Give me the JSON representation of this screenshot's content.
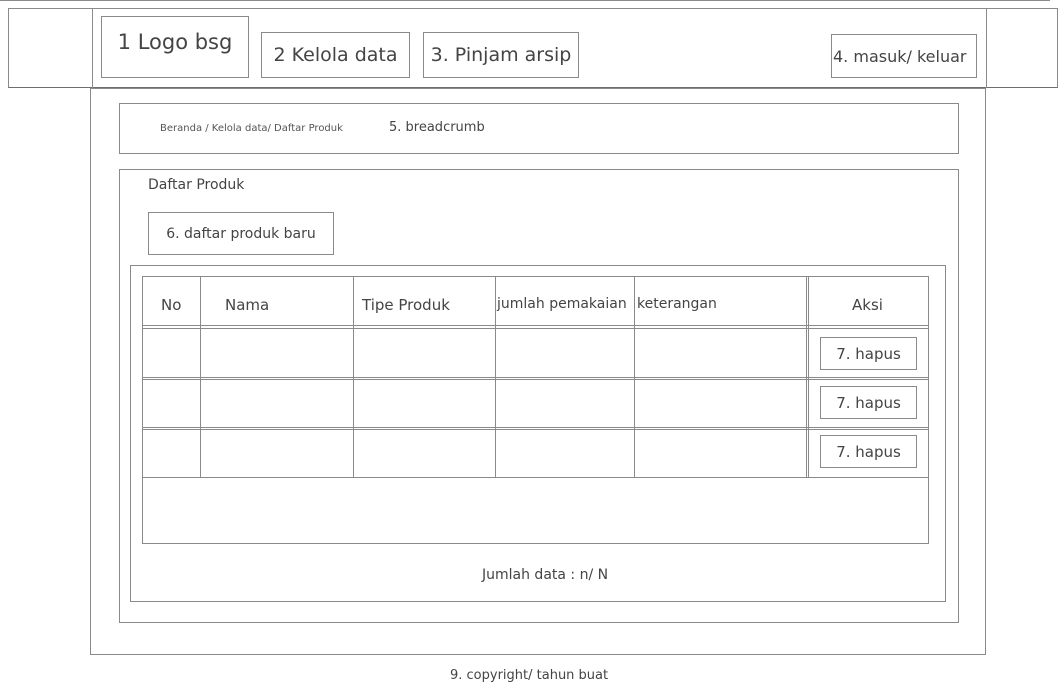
{
  "header": {
    "logo": "1 Logo bsg",
    "nav_kelola": "2 Kelola data",
    "nav_pinjam": "3. Pinjam arsip",
    "auth": "4. masuk/ keluar"
  },
  "breadcrumb": {
    "path": "Beranda / Kelola data/ Daftar Produk",
    "note": "5. breadcrumb"
  },
  "list": {
    "title": "Daftar Produk",
    "add_button": "6. daftar produk baru",
    "columns": [
      "No",
      "Nama",
      "Tipe Produk",
      "jumlah pemakaian",
      "keterangan",
      "Aksi"
    ],
    "rows": [
      {
        "action": "7. hapus"
      },
      {
        "action": "7. hapus"
      },
      {
        "action": "7. hapus"
      }
    ],
    "total": "Jumlah data : n/ N"
  },
  "footer": {
    "copyright": "9. copyright/ tahun buat"
  }
}
